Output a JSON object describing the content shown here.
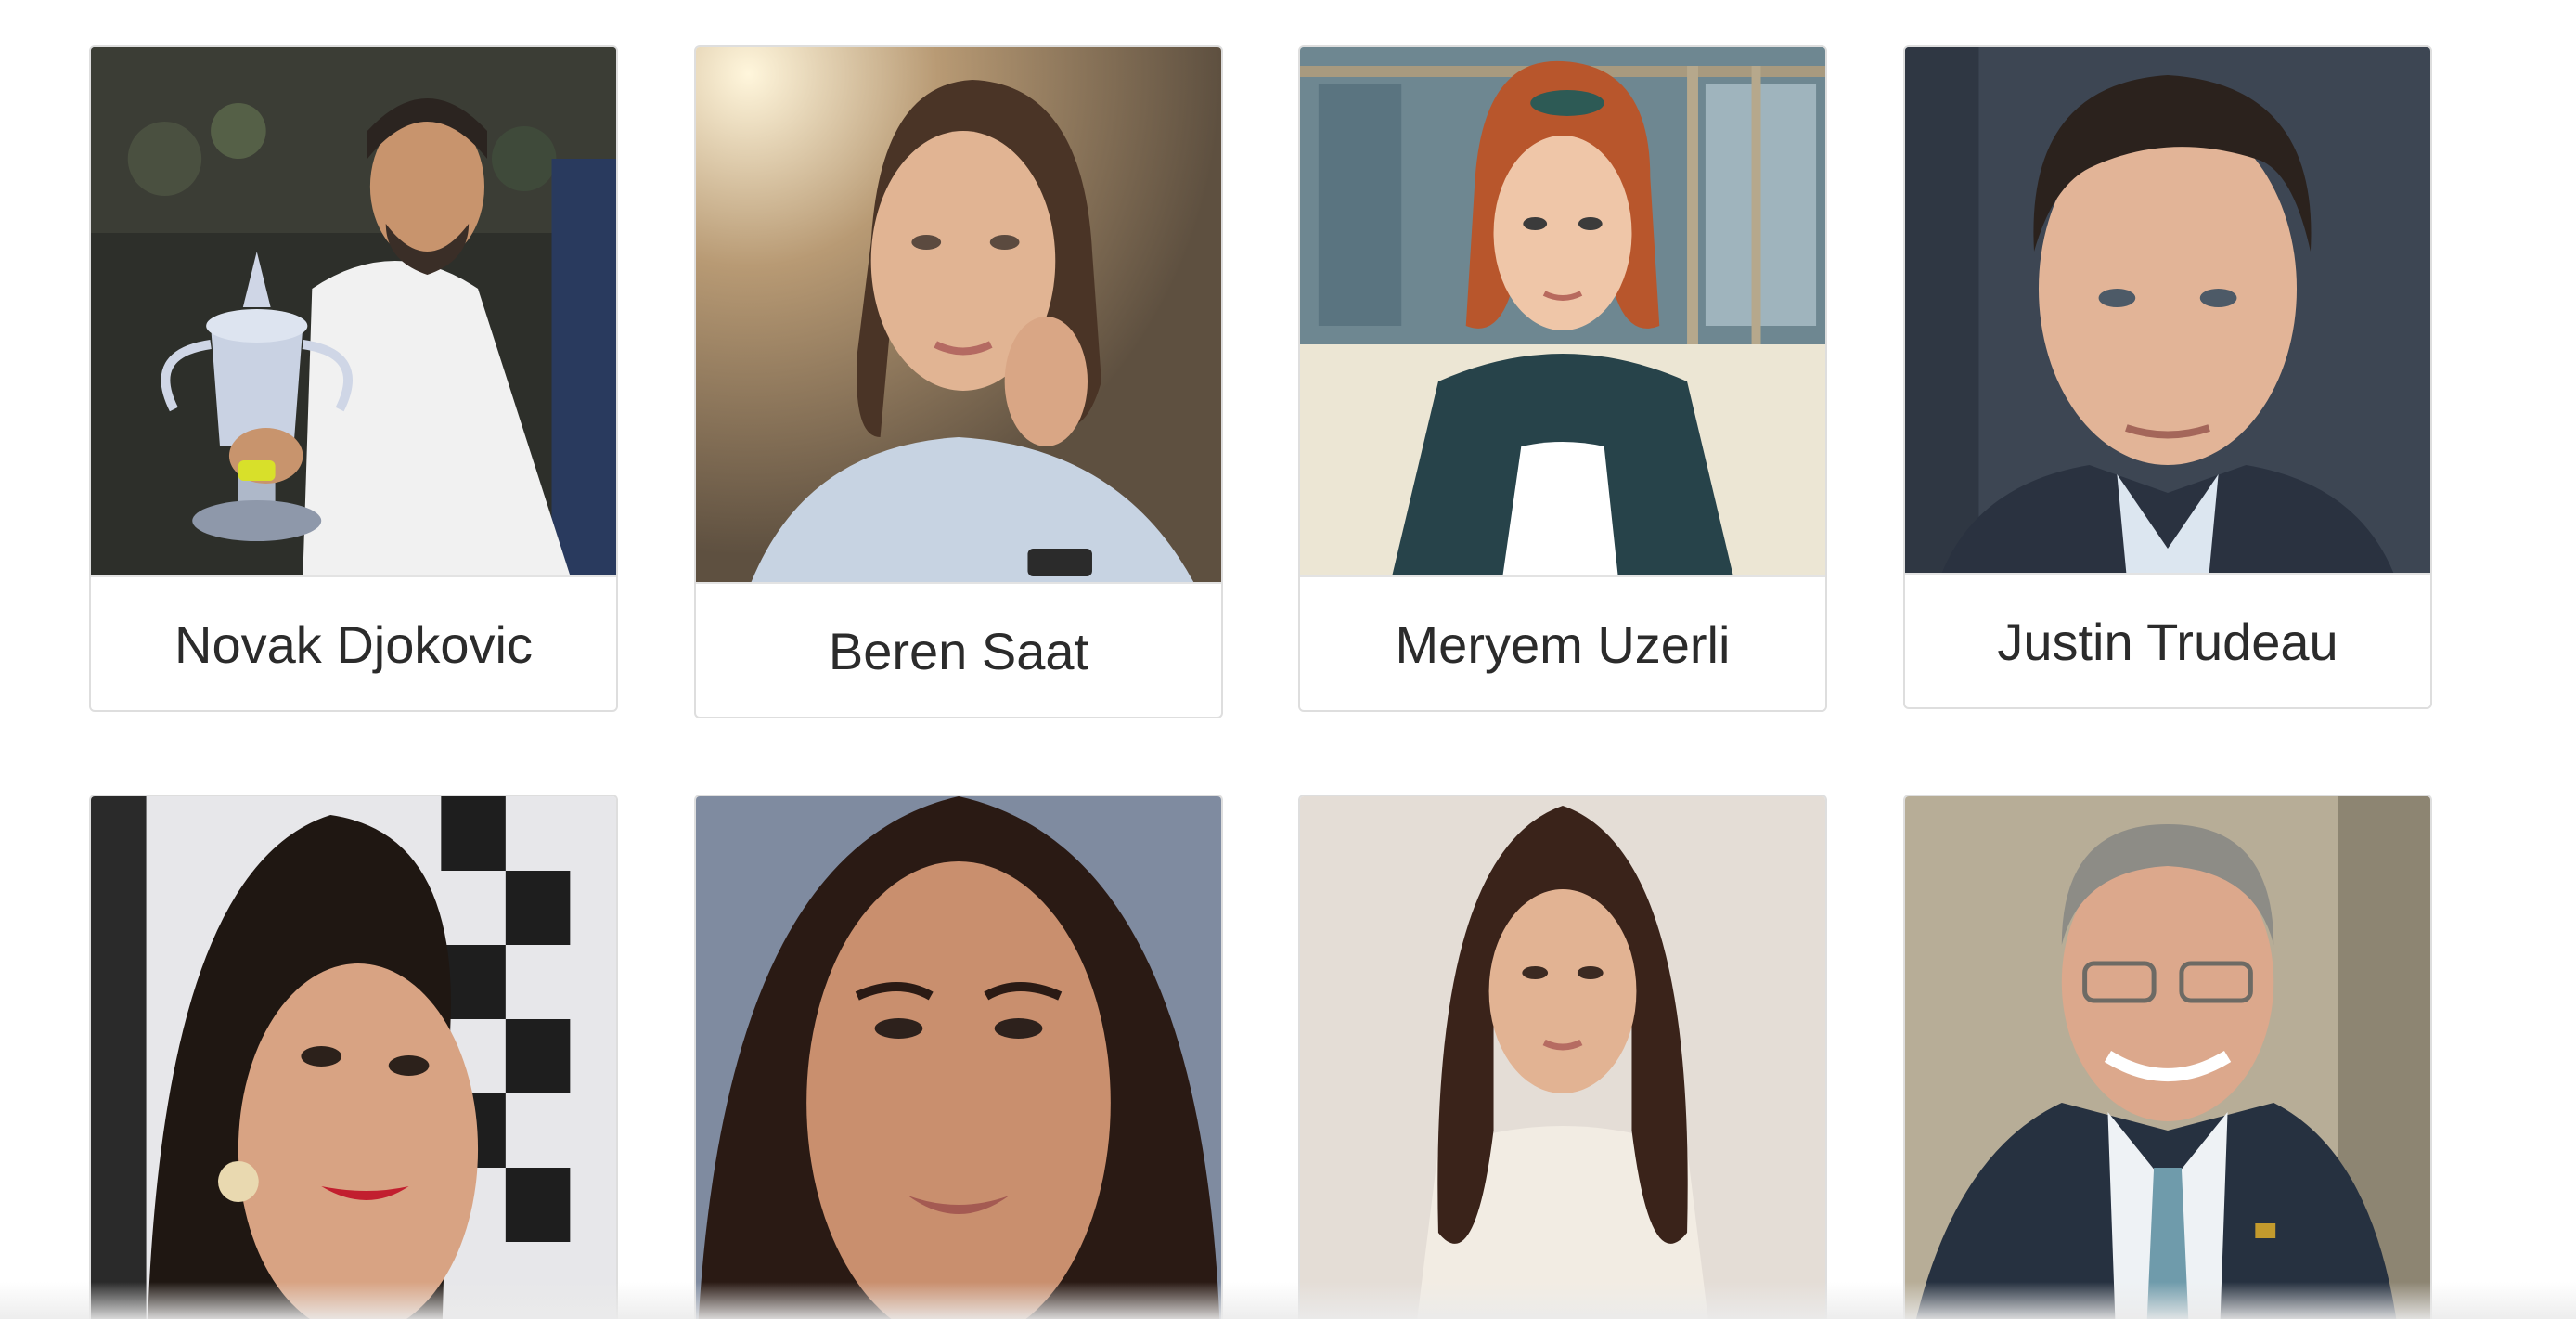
{
  "cards": [
    {
      "name": "Novak Djokovic",
      "photo": "portrait-tennis-trophy"
    },
    {
      "name": "Beren Saat",
      "photo": "portrait-woman-ponytail"
    },
    {
      "name": "Meryem Uzerli",
      "photo": "portrait-woman-red-hair"
    },
    {
      "name": "Justin Trudeau",
      "photo": "portrait-man-suit"
    },
    {
      "name": "",
      "photo": "portrait-woman-dark-hair"
    },
    {
      "name": "",
      "photo": "portrait-woman-closeup"
    },
    {
      "name": "",
      "photo": "portrait-woman-white-dress"
    },
    {
      "name": "",
      "photo": "portrait-man-glasses"
    }
  ]
}
